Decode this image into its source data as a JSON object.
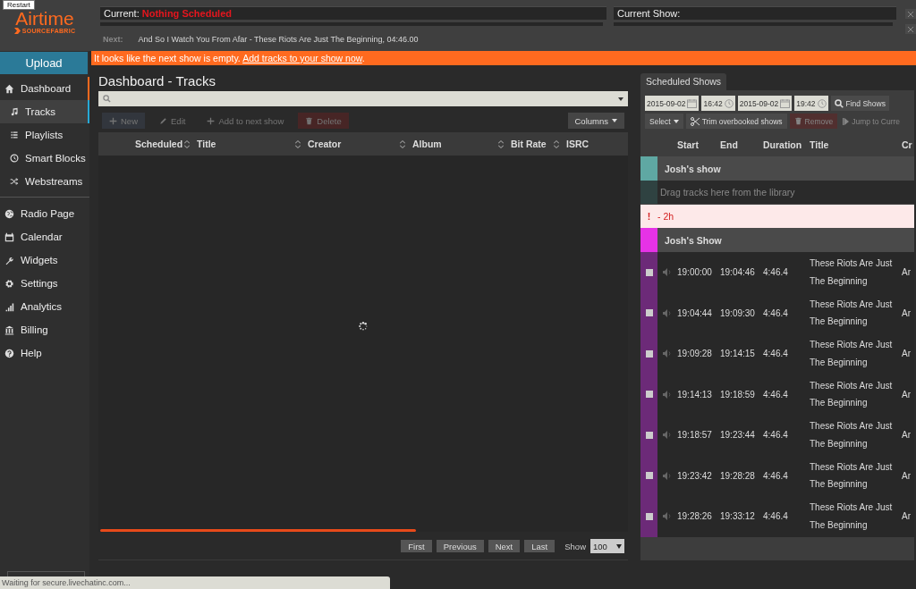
{
  "tooltip": "Restart",
  "logo": {
    "name": "Airtime",
    "brand": "SOURCEFABRIC"
  },
  "now_playing": {
    "current_label": "Current:",
    "current_value": "Nothing Scheduled",
    "current_show_label": "Current Show:",
    "next_label": "Next:",
    "next_value": "And So I Watch You From Afar - These Riots Are Just The Beginning, 04:46.00"
  },
  "upload_button": "Upload",
  "alert": {
    "text": "It looks like the next show is empty.",
    "link": "Add tracks to your show now",
    "end": "."
  },
  "sidebar": {
    "items": [
      {
        "label": "Dashboard",
        "expanded": true,
        "children": [
          {
            "label": "Tracks",
            "selected": true
          },
          {
            "label": "Playlists",
            "selected": false
          },
          {
            "label": "Smart Blocks",
            "selected": false
          },
          {
            "label": "Webstreams",
            "selected": false
          }
        ]
      },
      {
        "label": "Radio Page",
        "expanded": false
      },
      {
        "label": "Calendar",
        "expanded": false
      },
      {
        "label": "Widgets",
        "expanded": false
      },
      {
        "label": "Settings",
        "expanded": false
      },
      {
        "label": "Analytics",
        "expanded": false
      },
      {
        "label": "Billing",
        "expanded": false
      },
      {
        "label": "Help",
        "expanded": false
      }
    ]
  },
  "tracks": {
    "title": "Dashboard - Tracks",
    "toolbar": [
      {
        "label": "New",
        "kind": "new",
        "disabled": true
      },
      {
        "label": "Edit",
        "kind": "edit",
        "disabled": true
      },
      {
        "label": "Add to next show",
        "kind": "add",
        "disabled": true
      },
      {
        "label": "Delete",
        "kind": "delete",
        "disabled": true
      }
    ],
    "columns_button": "Columns",
    "columns": [
      "Scheduled",
      "Title",
      "Creator",
      "Album",
      "Bit Rate",
      "ISRC"
    ],
    "loading": {
      "level": 0.6
    },
    "pager": [
      "First",
      "Previous",
      "Next",
      "Last"
    ],
    "show_label": "Show",
    "show_value": "100"
  },
  "schedule": {
    "tab": "Scheduled Shows",
    "start_date": "2015-09-02",
    "start_time": "16:42",
    "end_date": "2015-09-02",
    "end_time": "19:42",
    "find_button": "Find Shows",
    "actions": [
      {
        "label": "Select",
        "kind": "dropdown",
        "disabled": false
      },
      {
        "label": "Trim overbooked shows",
        "kind": "scissors",
        "disabled": false
      },
      {
        "label": "Remove",
        "kind": "danger",
        "disabled": true
      },
      {
        "label": "Jump to Curre",
        "kind": "link",
        "disabled": true
      }
    ],
    "columns": [
      "Start",
      "End",
      "Duration",
      "Title",
      "Cr"
    ],
    "rows": [
      {
        "kind": "show",
        "title": "Josh's show",
        "color": "#5fa8a3"
      },
      {
        "kind": "empty",
        "text": "Drag tracks here from the library"
      },
      {
        "kind": "warning",
        "icon_text": "!",
        "text": "- 2h"
      },
      {
        "kind": "show",
        "title": "Josh's Show",
        "color": "#e632e6"
      },
      {
        "kind": "track",
        "checked": false,
        "start": "19:00:00",
        "end": "19:04:46",
        "duration": "4:46.4",
        "title": "These Riots Are Just The Beginning",
        "creator": "Ar"
      },
      {
        "kind": "track",
        "checked": false,
        "start": "19:04:44",
        "end": "19:09:30",
        "duration": "4:46.4",
        "title": "These Riots Are Just The Beginning",
        "creator": "Ar"
      },
      {
        "kind": "track",
        "checked": false,
        "start": "19:09:28",
        "end": "19:14:15",
        "duration": "4:46.4",
        "title": "These Riots Are Just The Beginning",
        "creator": "Ar"
      },
      {
        "kind": "track",
        "checked": false,
        "start": "19:14:13",
        "end": "19:18:59",
        "duration": "4:46.4",
        "title": "These Riots Are Just The Beginning",
        "creator": "Ar"
      },
      {
        "kind": "track",
        "checked": false,
        "start": "19:18:57",
        "end": "19:23:44",
        "duration": "4:46.4",
        "title": "These Riots Are Just The Beginning",
        "creator": "Ar"
      },
      {
        "kind": "track",
        "checked": false,
        "start": "19:23:42",
        "end": "19:28:28",
        "duration": "4:46.4",
        "title": "These Riots Are Just The Beginning",
        "creator": "Ar"
      },
      {
        "kind": "track",
        "checked": false,
        "start": "19:28:26",
        "end": "19:33:12",
        "duration": "4:46.4",
        "title": "These Riots Are Just The Beginning",
        "creator": "Ar"
      }
    ]
  },
  "status_bar": "Waiting for secure.livechatinc.com..."
}
